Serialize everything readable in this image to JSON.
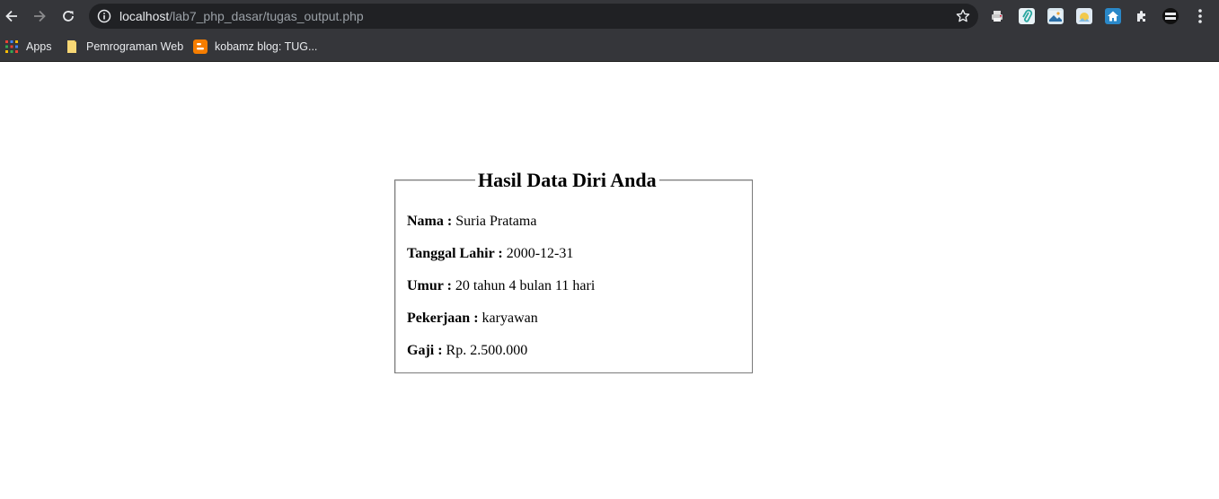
{
  "browser": {
    "url_host": "localhost",
    "url_path": "/lab7_php_dasar/tugas_output.php",
    "bookmarks": [
      {
        "label": "Apps",
        "icon": "apps-grid-icon"
      },
      {
        "label": "Pemrograman Web",
        "icon": "folder-icon"
      },
      {
        "label": "kobamz blog: TUG...",
        "icon": "blogger-icon"
      }
    ],
    "extensions": [
      "printer-extension-icon",
      "paperclip-extension-icon",
      "image-extension-icon",
      "photo-extension-icon",
      "home-extension-icon",
      "puzzle-icon",
      "pacman-extension-icon"
    ],
    "colors": {
      "chrome_bg": "#35363a",
      "omnibox_bg": "#202124",
      "blogger": "#f57d00",
      "folder": "#f8d775"
    }
  },
  "page": {
    "title": "Hasil Data Diri Anda",
    "fields": [
      {
        "label": "Nama :",
        "value": "Suria Pratama"
      },
      {
        "label": "Tanggal Lahir :",
        "value": "2000-12-31"
      },
      {
        "label": "Umur :",
        "value": "20 tahun 4 bulan 11 hari"
      },
      {
        "label": "Pekerjaan :",
        "value": "karyawan"
      },
      {
        "label": "Gaji :",
        "value": "Rp. 2.500.000"
      }
    ]
  }
}
